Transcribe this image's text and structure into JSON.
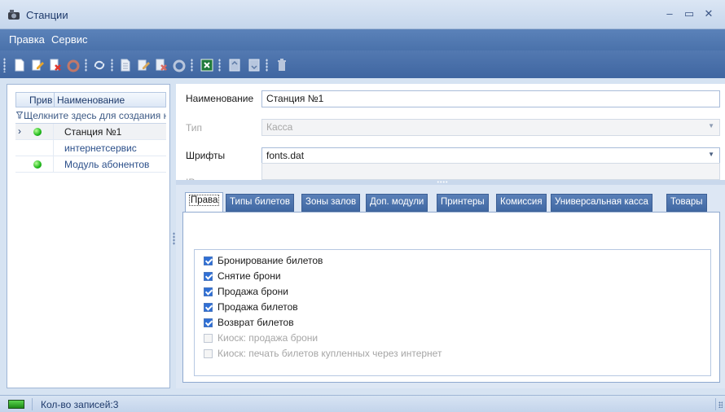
{
  "window": {
    "title": "Станции",
    "minimize": "–",
    "maximize": "▭",
    "close": "✕"
  },
  "menu": {
    "items": [
      "Правка",
      "Сервис"
    ]
  },
  "toolbar": {
    "buttons": [
      "new-icon",
      "edit-icon",
      "delete-icon",
      "undo-icon",
      "refresh-icon",
      "new-icon",
      "edit-icon",
      "delete-icon",
      "undo-icon",
      "excel-export-icon",
      "move-up-icon",
      "move-down-icon",
      "trash-icon"
    ]
  },
  "grid": {
    "columns": [
      "Прив",
      "Наименование"
    ],
    "new_row_hint": "Щелкните здесь для создания новой строки",
    "rows": [
      {
        "indicator": "›",
        "active": true,
        "name": "Станция №1",
        "selected": true
      },
      {
        "indicator": "",
        "active": false,
        "name": "интернетсервис",
        "selected": false
      },
      {
        "indicator": "",
        "active": true,
        "name": "Модуль абонентов",
        "selected": false
      }
    ]
  },
  "form": {
    "name_label": "Наименование",
    "name_value": "Станция №1",
    "type_label": "Тип",
    "type_value": "Касса",
    "fonts_label": "Шрифты",
    "fonts_value": "fonts.dat",
    "ip_label": "IP адрес",
    "ip_value": ""
  },
  "tabs": [
    "Права",
    "Типы билетов",
    "Зоны залов",
    "Доп. модули",
    "Принтеры",
    "Комиссия",
    "Универсальная касса",
    "Товары"
  ],
  "active_tab": "Права",
  "rights": [
    {
      "label": "Бронирование билетов",
      "checked": true,
      "enabled": true
    },
    {
      "label": "Снятие брони",
      "checked": true,
      "enabled": true
    },
    {
      "label": "Продажа брони",
      "checked": true,
      "enabled": true
    },
    {
      "label": "Продажа билетов",
      "checked": true,
      "enabled": true
    },
    {
      "label": "Возврат билетов",
      "checked": true,
      "enabled": true
    },
    {
      "label": "Киоск: продажа брони",
      "checked": false,
      "enabled": false
    },
    {
      "label": "Киоск: печать билетов купленных через интернет",
      "checked": false,
      "enabled": false
    }
  ],
  "status": {
    "records": "Кол-во записей:3"
  },
  "colors": {
    "menubar": "#4a72ab",
    "active_dot": "#1fb81a",
    "checkbox": "#2f6fd5"
  }
}
